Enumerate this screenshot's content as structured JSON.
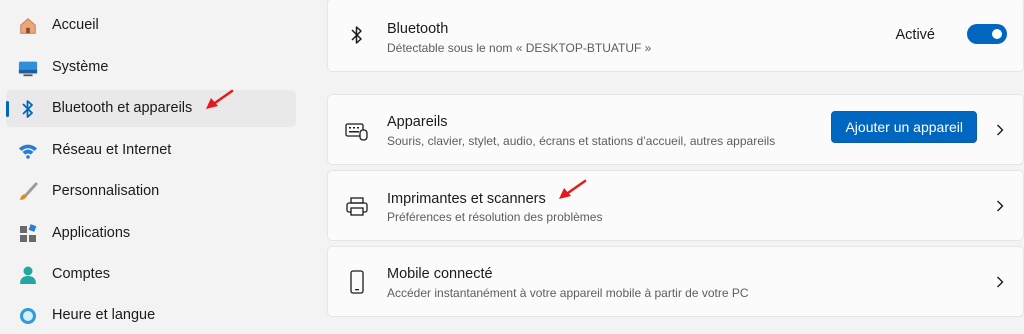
{
  "sidebar": {
    "items": [
      {
        "label": "Accueil",
        "icon": "home-icon"
      },
      {
        "label": "Système",
        "icon": "system-display-icon"
      },
      {
        "label": "Bluetooth et appareils",
        "icon": "bluetooth-icon",
        "selected": true
      },
      {
        "label": "Réseau et Internet",
        "icon": "wifi-icon"
      },
      {
        "label": "Personnalisation",
        "icon": "paintbrush-icon"
      },
      {
        "label": "Applications",
        "icon": "apps-icon"
      },
      {
        "label": "Comptes",
        "icon": "account-icon"
      },
      {
        "label": "Heure et langue",
        "icon": "globe-clock-icon"
      }
    ]
  },
  "bluetooth": {
    "title": "Bluetooth",
    "subtitle": "Détectable sous le nom « DESKTOP-BTUATUF »",
    "status": "Activé",
    "toggle_on": true
  },
  "devices": {
    "title": "Appareils",
    "subtitle": "Souris, clavier, stylet, audio, écrans et stations d’accueil, autres appareils",
    "button_label": "Ajouter un appareil"
  },
  "printers": {
    "title": "Imprimantes et scanners",
    "subtitle": "Préférences et résolution des problèmes"
  },
  "mobile": {
    "title": "Mobile connecté",
    "subtitle": "Accéder instantanément à votre appareil mobile à partir de votre PC"
  },
  "colors": {
    "accent": "#0067c0",
    "annotation_arrow": "#e8191b",
    "background": "#f3f3f3",
    "card": "#fbfbfb"
  }
}
